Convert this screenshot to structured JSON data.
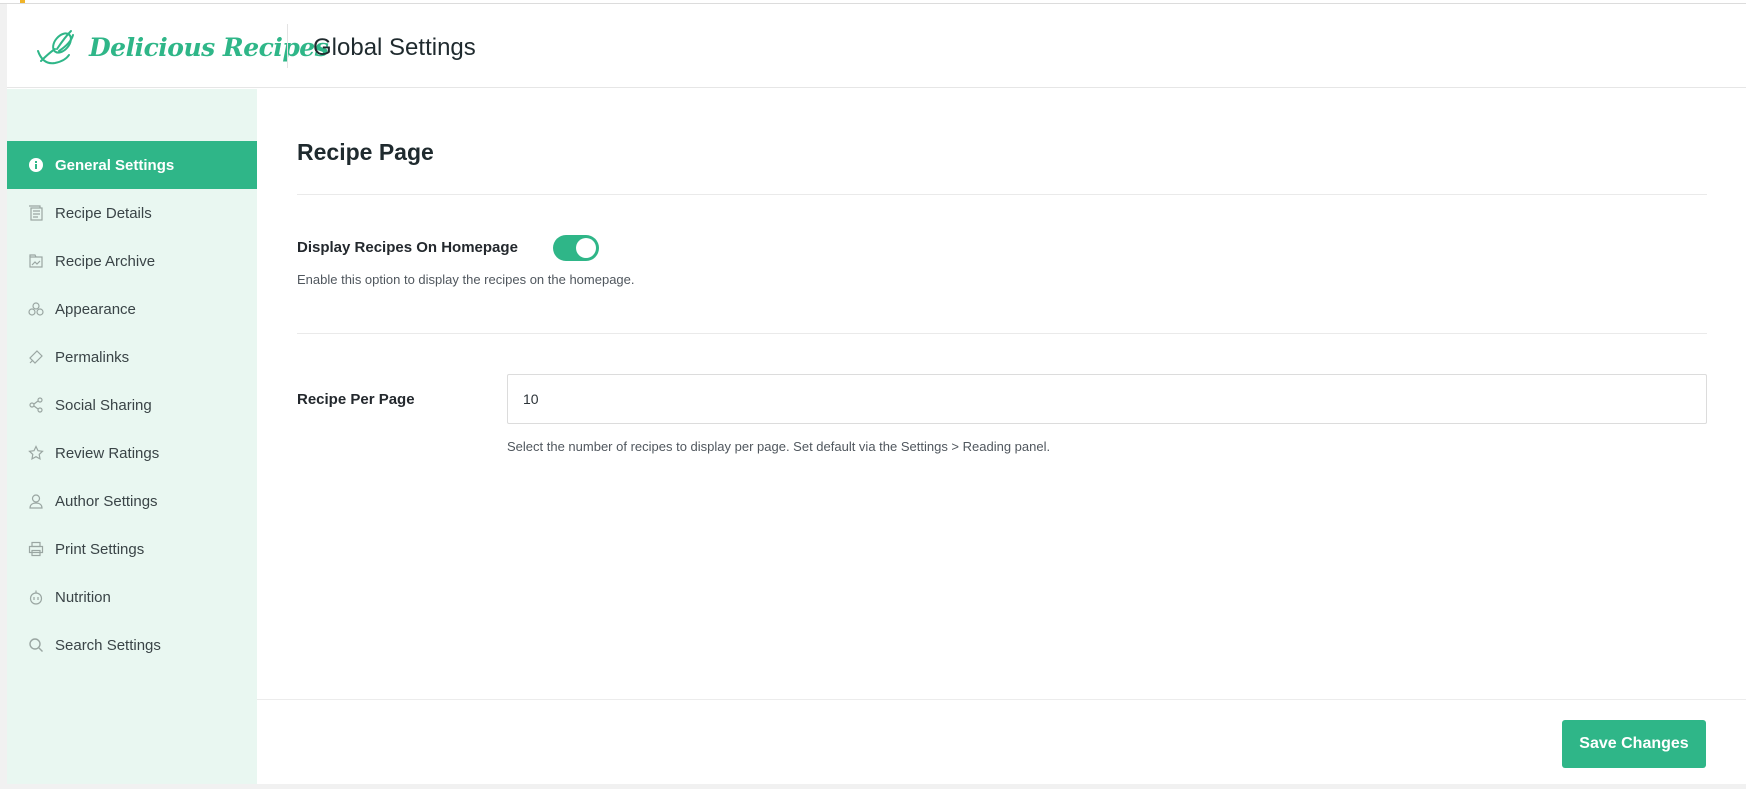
{
  "header": {
    "logo_text": "Delicious Recipes",
    "title": "Global Settings"
  },
  "sidebar": {
    "items": [
      {
        "label": "General Settings",
        "icon": "info-icon",
        "active": true
      },
      {
        "label": "Recipe Details",
        "icon": "details-icon",
        "active": false
      },
      {
        "label": "Recipe Archive",
        "icon": "archive-icon",
        "active": false
      },
      {
        "label": "Appearance",
        "icon": "appearance-icon",
        "active": false
      },
      {
        "label": "Permalinks",
        "icon": "link-icon",
        "active": false
      },
      {
        "label": "Social Sharing",
        "icon": "share-icon",
        "active": false
      },
      {
        "label": "Review Ratings",
        "icon": "star-icon",
        "active": false
      },
      {
        "label": "Author Settings",
        "icon": "user-icon",
        "active": false
      },
      {
        "label": "Print Settings",
        "icon": "printer-icon",
        "active": false
      },
      {
        "label": "Nutrition",
        "icon": "apple-icon",
        "active": false
      },
      {
        "label": "Search Settings",
        "icon": "search-icon",
        "active": false
      }
    ]
  },
  "main": {
    "section_title": "Recipe Page",
    "display_homepage": {
      "label": "Display Recipes On Homepage",
      "enabled": true,
      "help": "Enable this option to display the recipes on the homepage."
    },
    "per_page": {
      "label": "Recipe Per Page",
      "value": "10",
      "help": "Select the number of recipes to display per page. Set default via the Settings > Reading panel."
    }
  },
  "footer": {
    "save_label": "Save Changes"
  },
  "colors": {
    "accent": "#2fb688",
    "sidebar_bg": "#e9f7f1"
  }
}
